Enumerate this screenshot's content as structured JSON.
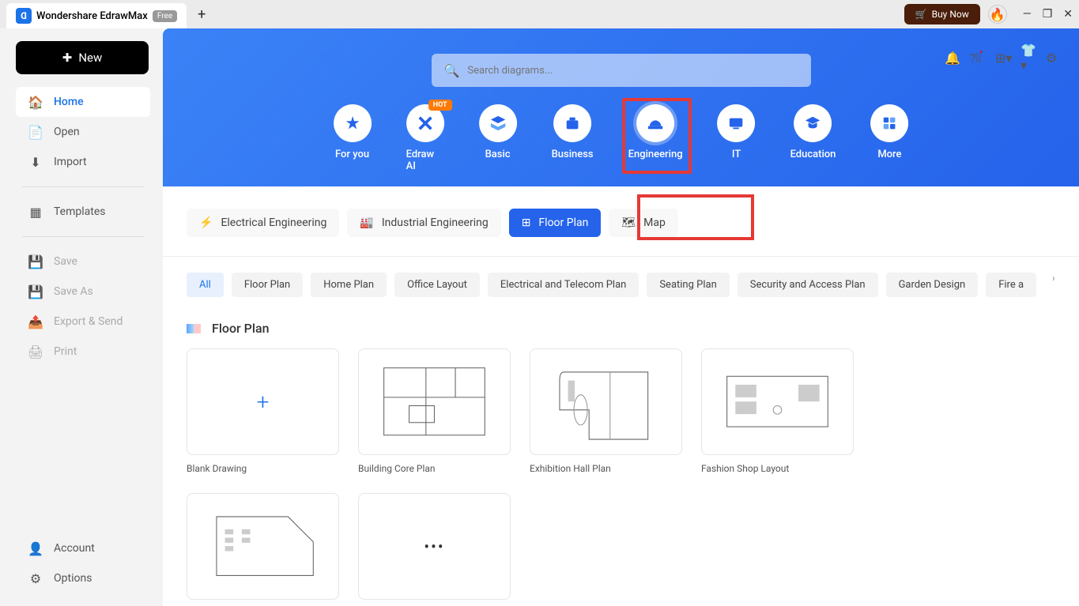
{
  "title_bar": {
    "app_name": "Wondershare EdrawMax",
    "free_badge": "Free",
    "buy_now": "Buy Now"
  },
  "sidebar": {
    "new_btn": "New",
    "items": [
      {
        "label": "Home",
        "icon": "🏠"
      },
      {
        "label": "Open",
        "icon": "📄"
      },
      {
        "label": "Import",
        "icon": "⬇"
      }
    ],
    "templates": "Templates",
    "file_items": [
      {
        "label": "Save"
      },
      {
        "label": "Save As"
      },
      {
        "label": "Export & Send"
      },
      {
        "label": "Print"
      }
    ],
    "bottom_items": [
      {
        "label": "Account"
      },
      {
        "label": "Options"
      }
    ]
  },
  "search": {
    "placeholder": "Search diagrams..."
  },
  "categories": [
    {
      "label": "For you"
    },
    {
      "label": "Edraw AI",
      "hot": "HOT"
    },
    {
      "label": "Basic"
    },
    {
      "label": "Business"
    },
    {
      "label": "Engineering",
      "active": true
    },
    {
      "label": "IT"
    },
    {
      "label": "Education"
    },
    {
      "label": "More"
    }
  ],
  "sub_categories": [
    {
      "label": "Electrical Engineering"
    },
    {
      "label": "Industrial Engineering"
    },
    {
      "label": "Floor Plan",
      "active": true
    },
    {
      "label": "Map"
    }
  ],
  "filter_chips": [
    {
      "label": "All",
      "active": true
    },
    {
      "label": "Floor Plan"
    },
    {
      "label": "Home Plan"
    },
    {
      "label": "Office Layout"
    },
    {
      "label": "Electrical and Telecom Plan"
    },
    {
      "label": "Seating Plan"
    },
    {
      "label": "Security and Access Plan"
    },
    {
      "label": "Garden Design"
    },
    {
      "label": "Fire a"
    }
  ],
  "section": {
    "title": "Floor Plan"
  },
  "templates": [
    {
      "label": "Blank Drawing",
      "blank": true
    },
    {
      "label": "Building Core Plan"
    },
    {
      "label": "Exhibition Hall Plan"
    },
    {
      "label": "Fashion Shop Layout"
    }
  ]
}
